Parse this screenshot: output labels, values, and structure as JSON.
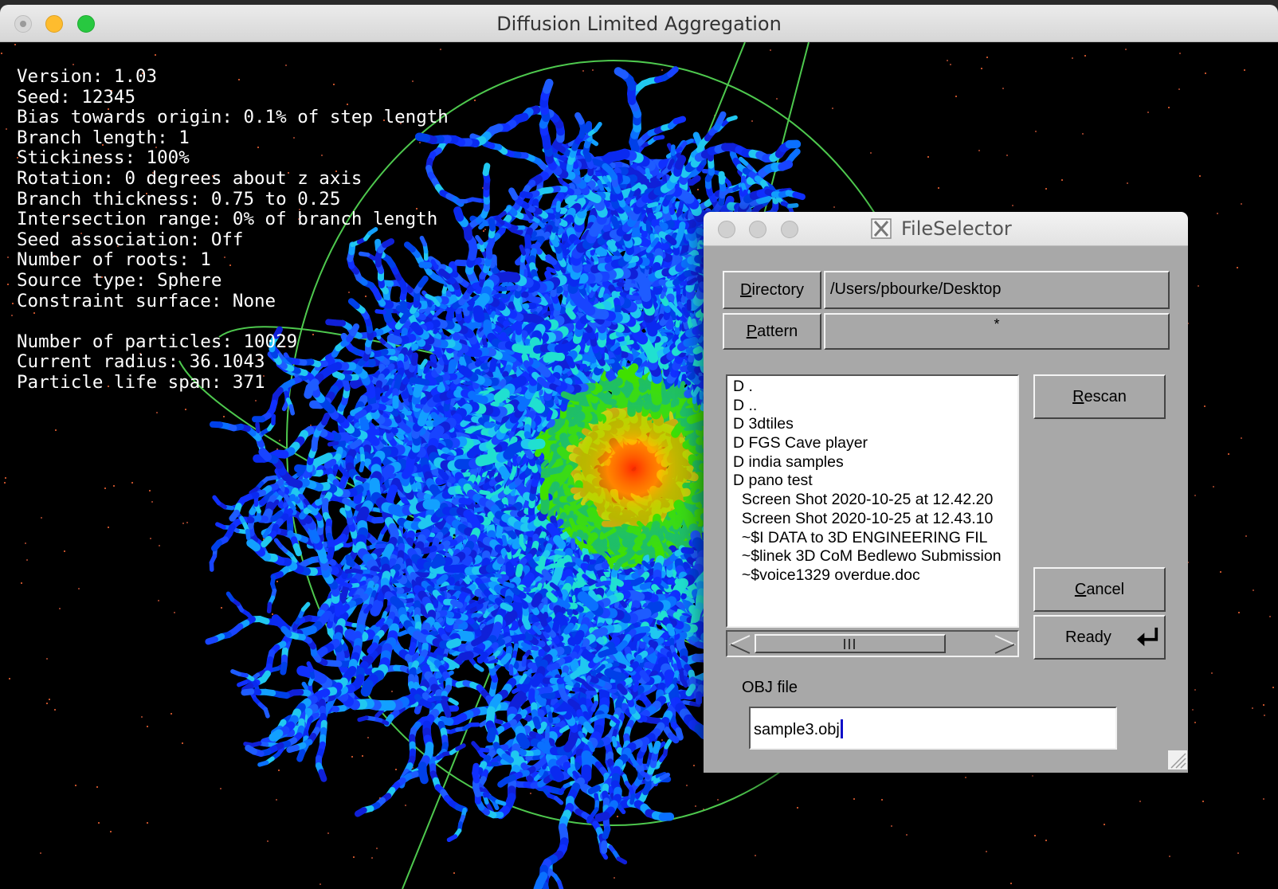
{
  "window": {
    "title": "Diffusion Limited Aggregation"
  },
  "info_lines": [
    "Version: 1.03",
    "Seed: 12345",
    "Bias towards origin: 0.1% of step length",
    "Branch length: 1",
    "Stickiness: 100%",
    "Rotation: 0 degrees about z axis",
    "Branch thickness: 0.75 to 0.25",
    "Intersection range: 0% of branch length",
    "Seed association: Off",
    "Number of roots: 1",
    "Source type: Sphere",
    "Constraint surface: None",
    "",
    "Number of particles: 10029",
    "Current radius: 36.1043",
    "Particle life span: 371"
  ],
  "file_selector": {
    "title": "FileSelector",
    "directory": {
      "label_mnemonic": "D",
      "label_rest": "irectory",
      "value": "/Users/pbourke/Desktop"
    },
    "pattern": {
      "label_mnemonic": "P",
      "label_rest": "attern",
      "value": "*"
    },
    "files": [
      "D .",
      "D ..",
      "D 3dtiles",
      "D FGS Cave player",
      "D india samples",
      "D pano test",
      "  Screen Shot 2020-10-25 at 12.42.20",
      "  Screen Shot 2020-10-25 at 12.43.10",
      "  ~$I DATA to 3D ENGINEERING FIL",
      "  ~$linek 3D CoM Bedlewo Submission",
      "  ~$voice1329 overdue.doc"
    ],
    "rescan": {
      "mnemonic": "R",
      "rest": "escan"
    },
    "cancel": {
      "mnemonic": "C",
      "rest": "ancel"
    },
    "ready_label": "Ready",
    "obj_label": "OBJ file",
    "obj_value": "sample3.obj"
  },
  "colors": {
    "traffic_close": "#ff5f57",
    "traffic_minimize": "#febc2e",
    "traffic_zoom": "#28c840",
    "orbit_lines": "#4ec94e",
    "dialog_face": "#a8a8a8"
  }
}
